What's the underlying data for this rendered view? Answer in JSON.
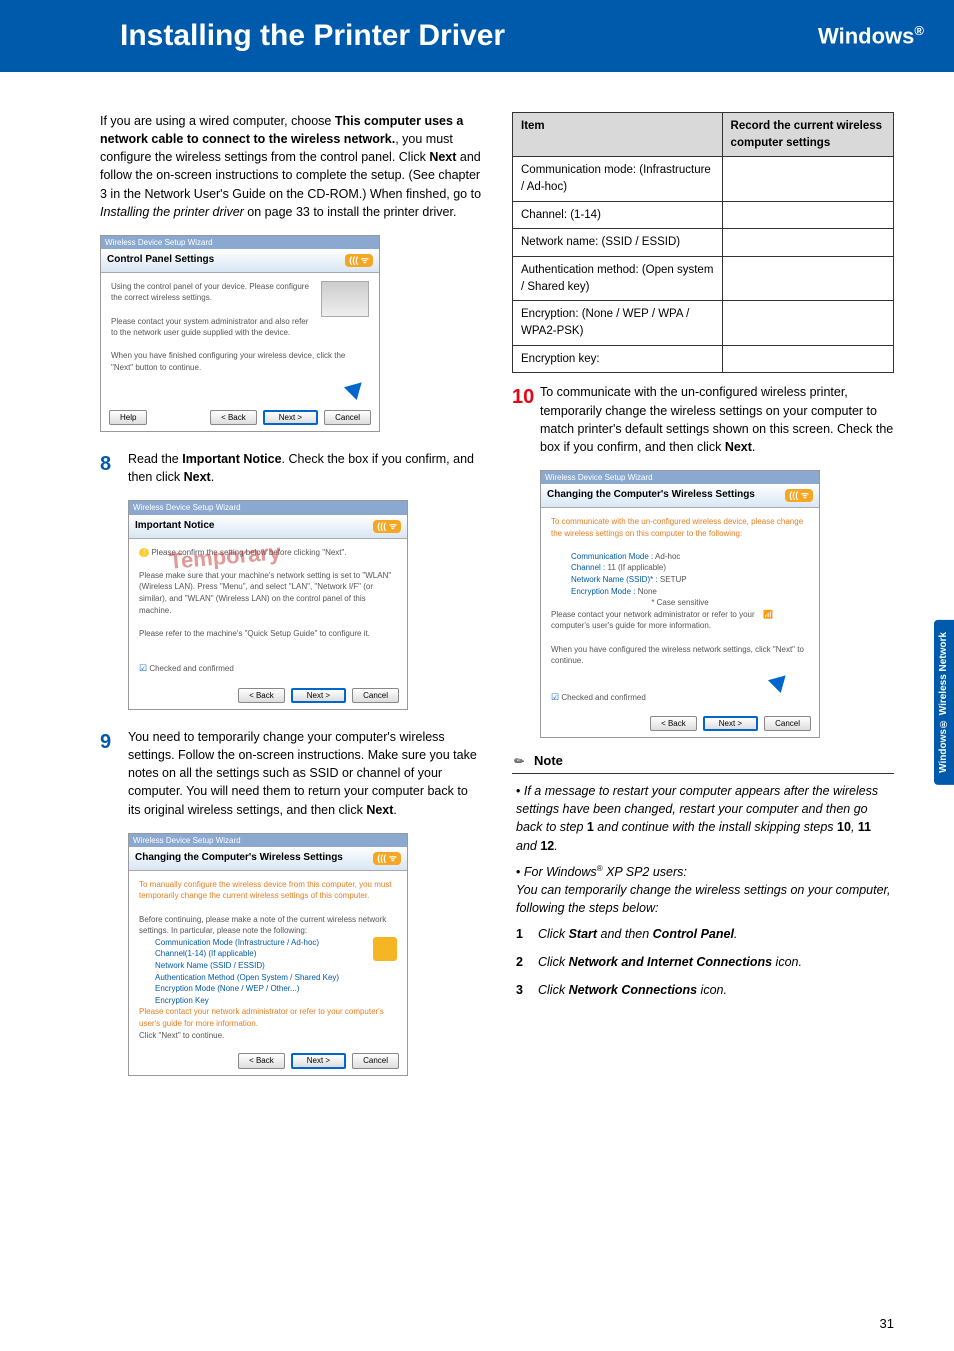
{
  "header": {
    "title": "Installing the Printer Driver",
    "platform": "Windows",
    "reg": "®"
  },
  "side_tab": "Windows®\nWireless\nNetwork",
  "page_number": "31",
  "left": {
    "intro": {
      "p1_pre": "If you are using a wired computer, choose ",
      "p1_bold": "This computer uses a network cable to connect to the wireless network.",
      "p1_mid": ", you must configure the wireless settings from the control panel. Click ",
      "p1_next": "Next",
      "p1_post": " and follow the on-screen instructions to complete the setup. (See chapter 3 in the Network User's Guide on the CD-ROM.) When finshed, go to ",
      "p1_link": "Installing the printer driver",
      "p1_end": " on page 33 to install the printer driver."
    },
    "shot1": {
      "bar": "Wireless Device Setup Wizard",
      "title": "Control Panel Settings",
      "l1": "Using the control panel of your device. Please configure the correct wireless settings.",
      "l2": "Please contact your system administrator and also refer to the network user guide supplied with the device.",
      "l3": "When you have finished configuring your wireless device, click the \"Next\" button to continue.",
      "help": "Help",
      "back": "< Back",
      "next": "Next >",
      "cancel": "Cancel"
    },
    "step8": {
      "num": "8",
      "pre": "Read the ",
      "bold": "Important Notice",
      "mid": ". Check the box if you confirm, and then click ",
      "next": "Next",
      "end": "."
    },
    "shot2": {
      "bar": "Wireless Device Setup Wizard",
      "title": "Important Notice",
      "l1": "Please confirm the setting below before clicking \"Next\".",
      "l2": "Please make sure that your machine's network setting is set to \"WLAN\" (Wireless LAN). Press \"Menu\", and select \"LAN\", \"Network I/F\" (or similar), and \"WLAN\" (Wireless LAN) on the control panel of this machine.",
      "l3": "Please refer to the machine's \"Quick Setup Guide\" to configure it.",
      "chk": "Checked and confirmed",
      "back": "< Back",
      "next": "Next >",
      "cancel": "Cancel",
      "stamp": "Temporary"
    },
    "step9": {
      "num": "9",
      "p1": "You need to temporarily change your computer's wireless settings. Follow the on-screen instructions. Make sure you take notes on all the settings such as SSID or channel of your computer. You will need them to return your computer back to its original wireless settings, and then click ",
      "next": "Next",
      "end": "."
    },
    "shot3": {
      "bar": "Wireless Device Setup Wizard",
      "title": "Changing the Computer's Wireless Settings",
      "l1": "To manually configure the wireless device from this computer, you must temporarily change the current wireless settings of this computer.",
      "l2": "Before continuing, please make a note of the current wireless network settings. In particular, please note the following:",
      "i1": "Communication Mode (Infrastructure / Ad-hoc)",
      "i2": "Channel(1-14) (If applicable)",
      "i3": "Network Name (SSID / ESSID)",
      "i4": "Authentication Method (Open System / Shared Key)",
      "i5": "Encryption Mode (None / WEP / Other...)",
      "i6": "Encryption Key",
      "l3": "Please contact your network administrator or refer to your computer's user's guide for more information.",
      "l4": "Click \"Next\" to continue.",
      "back": "< Back",
      "next": "Next >",
      "cancel": "Cancel"
    }
  },
  "right": {
    "table": {
      "h1": "Item",
      "h2": "Record the current wireless computer settings",
      "r1": "Communication mode: (Infrastructure / Ad-hoc)",
      "r2": "Channel: (1-14)",
      "r3": "Network name: (SSID / ESSID)",
      "r4": "Authentication method: (Open system / Shared key)",
      "r5": "Encryption: (None / WEP / WPA / WPA2-PSK)",
      "r6": "Encryption key:"
    },
    "step10": {
      "num": "10",
      "p1": "To communicate with the un-configured wireless printer, temporarily change the wireless settings on your computer to match printer's default settings shown on this screen. Check the box if you confirm, and then click ",
      "next": "Next",
      "end": "."
    },
    "shot4": {
      "bar": "Wireless Device Setup Wizard",
      "title": "Changing the Computer's Wireless Settings",
      "l1": "To communicate with the un-configured wireless device, please change the wireless settings on this computer to the following:",
      "i1a": "Communication Mode :",
      "i1b": "Ad-hoc",
      "i2a": "Channel :",
      "i2b": "11    (If applicable)",
      "i3a": "Network Name (SSID)* :",
      "i3b": "SETUP",
      "i4a": "Encryption Mode :",
      "i4b": "None",
      "cs": "* Case sensitive",
      "l2": "Please contact your network administrator or refer to your computer's user's guide for more information.",
      "l3": "When you have configured the wireless network settings, click \"Next\" to continue.",
      "chk": "Checked and confirmed",
      "back": "< Back",
      "next": "Next >",
      "cancel": "Cancel"
    },
    "note": {
      "label": "Note",
      "b1_pre": "If a message to restart your computer appears after the wireless settings have been changed, restart your computer and then go back to step ",
      "b1_s1": "1",
      "b1_mid": " and continue with the install skipping steps ",
      "b1_s10": "10",
      "b1_c": ", ",
      "b1_s11": "11",
      "b1_and": " and ",
      "b1_s12": "12",
      "b1_end": ".",
      "b2_pre": "For Windows",
      "b2_reg": "®",
      "b2_sp": " XP SP2 users:",
      "b2_p": "You can temporarily change the wireless settings on your computer, following the steps below:",
      "s1n": "1",
      "s1_pre": "Click ",
      "s1_b1": "Start",
      "s1_mid": " and then ",
      "s1_b2": "Control Panel",
      "s1_end": ".",
      "s2n": "2",
      "s2_pre": "Click ",
      "s2_b": "Network and Internet Connections",
      "s2_end": " icon.",
      "s3n": "3",
      "s3_pre": "Click ",
      "s3_b": "Network Connections",
      "s3_end": " icon."
    }
  }
}
